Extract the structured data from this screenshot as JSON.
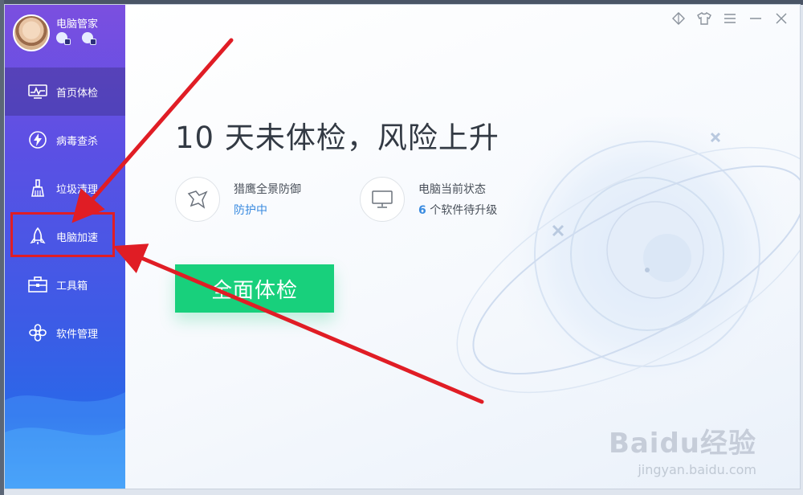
{
  "app": {
    "username": "电脑管家"
  },
  "sidebar": {
    "items": [
      {
        "label": "首页体检",
        "icon": "pulse-monitor-icon",
        "active": true
      },
      {
        "label": "病毒查杀",
        "icon": "lightning-shield-icon",
        "active": false
      },
      {
        "label": "垃圾清理",
        "icon": "broom-icon",
        "active": false
      },
      {
        "label": "电脑加速",
        "icon": "rocket-icon",
        "active": false
      },
      {
        "label": "工具箱",
        "icon": "toolbox-icon",
        "active": false
      },
      {
        "label": "软件管理",
        "icon": "clover-apps-icon",
        "active": false
      }
    ]
  },
  "main": {
    "headline": "10 天未体检，风险上升",
    "status_defense": {
      "title": "猎鹰全景防御",
      "value": "防护中"
    },
    "status_pc": {
      "title": "电脑当前状态",
      "count": "6",
      "value_rest": " 个软件待升级"
    },
    "scan_button": "全面体检"
  },
  "titlebar": {
    "icons": [
      "diamond-icon",
      "tshirt-icon",
      "menu-icon",
      "minimize-icon",
      "close-icon"
    ]
  },
  "annotation": {
    "highlight_color": "#e01d25",
    "arrow_color": "#e01d25"
  },
  "watermark": {
    "logo": "Baidu经验",
    "url": "jingyan.baidu.com"
  },
  "colors": {
    "sidebar_top": "#7b4fe0",
    "sidebar_bottom": "#3a8cf2",
    "accent_green": "#18d07c",
    "accent_blue": "#3a8be0"
  }
}
